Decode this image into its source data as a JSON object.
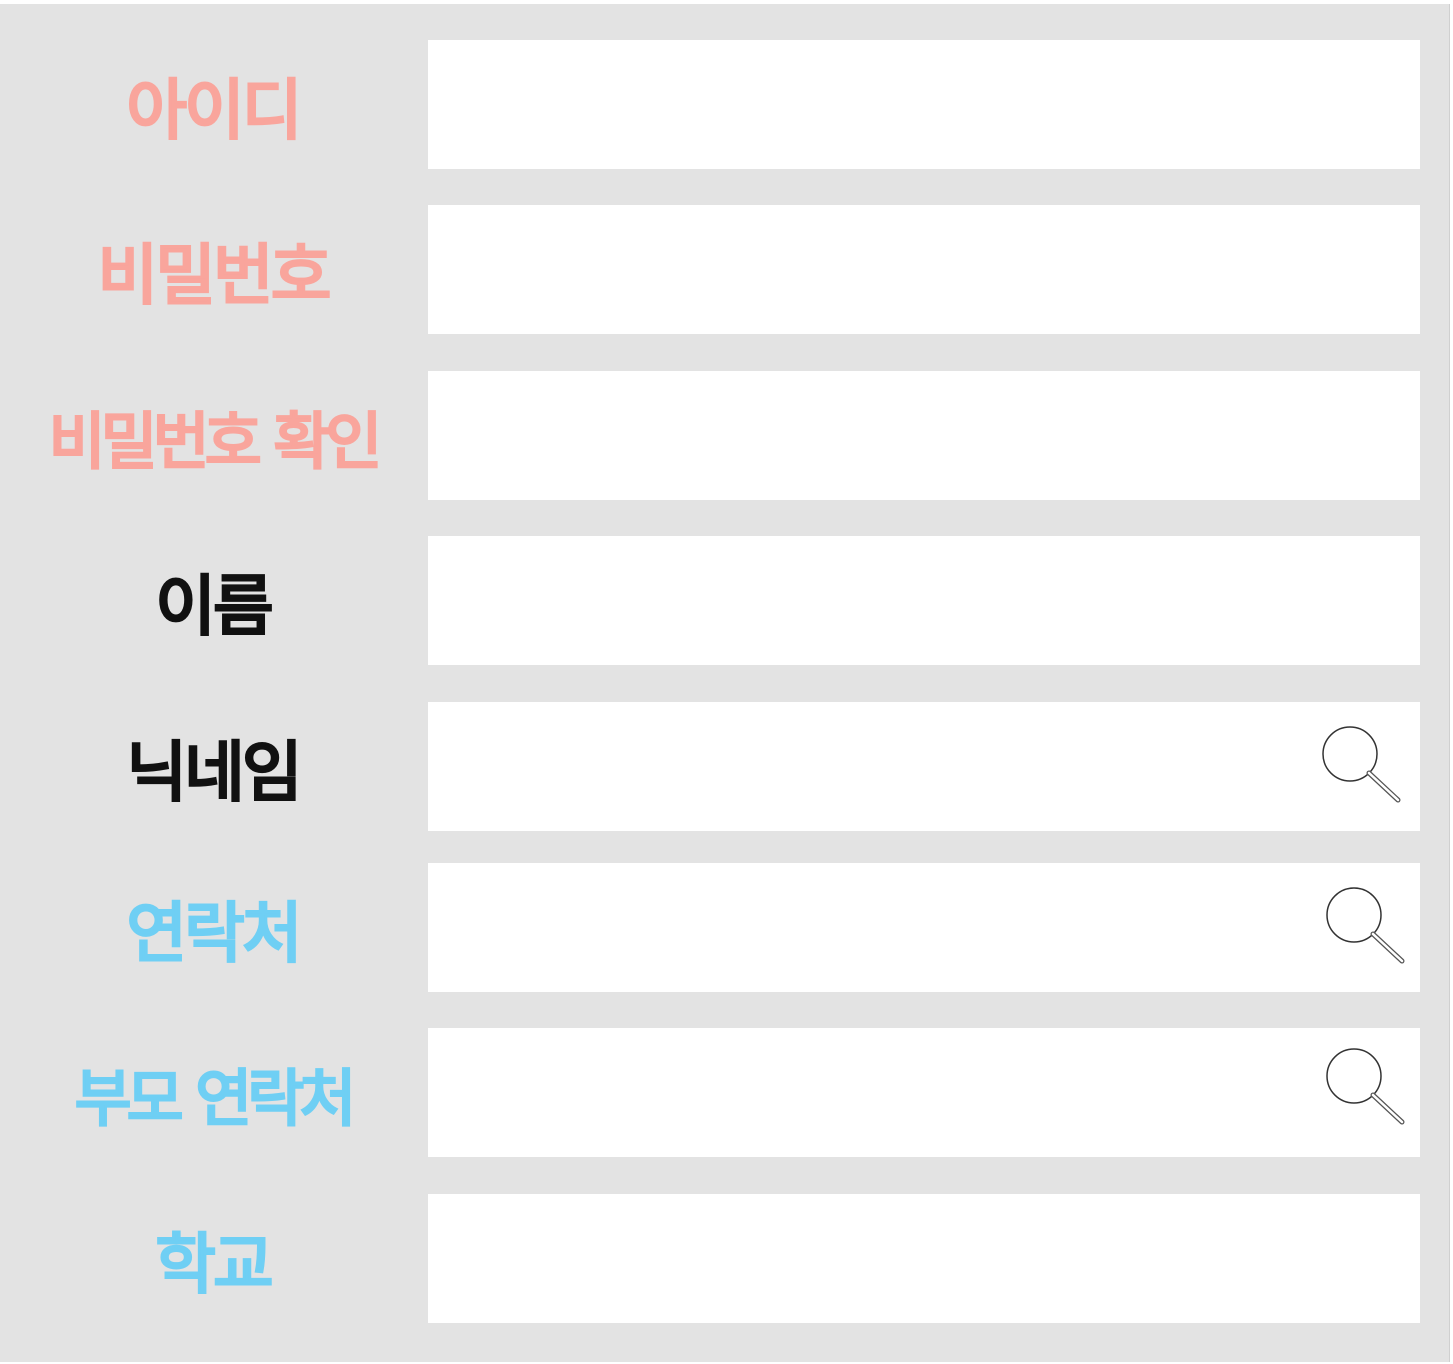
{
  "colors": {
    "panel_background": "#e3e3e3",
    "field_background": "#ffffff",
    "label_pink": "#f9a59c",
    "label_black": "#111111",
    "label_blue": "#6fcff4"
  },
  "form": {
    "rows": [
      {
        "label": "아이디",
        "value": "",
        "color": "#f9a59c",
        "has_search_icon": false
      },
      {
        "label": "비밀번호",
        "value": "",
        "color": "#f9a59c",
        "has_search_icon": false
      },
      {
        "label": "비밀번호 확인",
        "value": "",
        "color": "#f9a59c",
        "has_search_icon": false
      },
      {
        "label": "이름",
        "value": "",
        "color": "#111111",
        "has_search_icon": false
      },
      {
        "label": "닉네임",
        "value": "",
        "color": "#111111",
        "has_search_icon": true,
        "icon": "search-icon"
      },
      {
        "label": "연락처",
        "value": "",
        "color": "#6fcff4",
        "has_search_icon": true,
        "icon": "search-icon"
      },
      {
        "label": "부모 연락처",
        "value": "",
        "color": "#6fcff4",
        "has_search_icon": true,
        "icon": "search-icon"
      },
      {
        "label": "학교",
        "value": "",
        "color": "#6fcff4",
        "has_search_icon": false
      }
    ]
  }
}
